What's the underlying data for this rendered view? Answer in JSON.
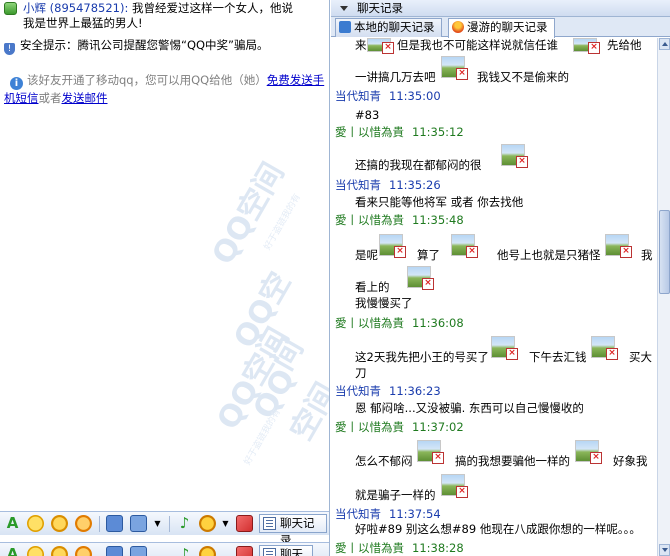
{
  "left": {
    "top_message": {
      "sender": "小辉 (895478521):",
      "text_line1": " 我曾经爱过这样一个女人，他说",
      "text_line2": "我是世界上最猛的男人!"
    },
    "security_tip": "安全提示：腾讯公司提醒您警惕“QQ中奖”骗局。",
    "mobile_tip": {
      "text": "该好友开通了移动qq，您可以用QQ给他（她）",
      "link1_a": "免费发送手",
      "link1_b": "机短信",
      "or": "或者",
      "link2": "发送邮件"
    },
    "watermark": "QQ空间",
    "watermark_small": "好于盗链我的有",
    "toolbar": {
      "history_label": "聊天记录",
      "history_label_short": "聊天",
      "icons": [
        "font-icon",
        "emoticon-icon",
        "shake-icon",
        "magic-face-icon",
        "screenshot-icon",
        "more-icon",
        "music-icon",
        "voice-icon",
        "gift-icon"
      ]
    }
  },
  "right": {
    "title": "聊天记录",
    "tabs": [
      {
        "label": "本地的聊天记录"
      },
      {
        "label": "漫游的聊天记录"
      }
    ],
    "entries": {
      "e0": {
        "text_a": "来",
        "text_b": "但是我也不可能这样说就信任谁",
        "text_c": "先给他"
      },
      "e1": {
        "text_a": "一讲搞几万去吧",
        "text_b": "我钱又不是偷来的"
      },
      "h1": {
        "name": "当代知青",
        "time": "11:35:00"
      },
      "t1": {
        "text": "#83"
      },
      "h2": {
        "name": "愛丨以惜為貴",
        "time": "11:35:12"
      },
      "t2": {
        "text": "还搞的我现在都郁闷的很"
      },
      "h3": {
        "name": "当代知青",
        "time": "11:35:26"
      },
      "t3": {
        "text": "看来只能等他将军 或者 你去找他"
      },
      "h4": {
        "name": "愛丨以惜為貴",
        "time": "11:35:48"
      },
      "t4": {
        "text_a": "是呢",
        "text_b": "算了",
        "text_c": "他号上也就是只猪怪",
        "text_d": "我"
      },
      "t4b": {
        "text": "看上的"
      },
      "t4c": {
        "text": "我慢慢买了"
      },
      "h5": {
        "name": "愛丨以惜為貴",
        "time": "11:36:08"
      },
      "t5": {
        "text_a": "这2天我先把小王的号买了",
        "text_b": "下午去汇钱",
        "text_c": "买大"
      },
      "t5b": {
        "text": "刀"
      },
      "h6": {
        "name": "当代知青",
        "time": "11:36:23"
      },
      "t6": {
        "text": "恩 郁闷啥...又没被骗. 东西可以自己慢慢收的"
      },
      "h7": {
        "name": "愛丨以惜為貴",
        "time": "11:37:02"
      },
      "t7": {
        "text_a": "怎么不郁闷",
        "text_b": "搞的我想要骗他一样的",
        "text_c": "好象我"
      },
      "t7b": {
        "text": "就是骗子一样的"
      },
      "h8": {
        "name": "当代知青",
        "time": "11:37:54"
      },
      "t8": {
        "text": "好啦#89 别这么想#89 他现在八成跟你想的一样呢。。。"
      },
      "h9": {
        "name": "愛丨以惜為貴",
        "time": "11:38:28"
      }
    }
  },
  "colors": {
    "self_name": "#1f7a1f",
    "other_name": "#1a3cad",
    "toolbar_bg": "#d8e4f4"
  }
}
